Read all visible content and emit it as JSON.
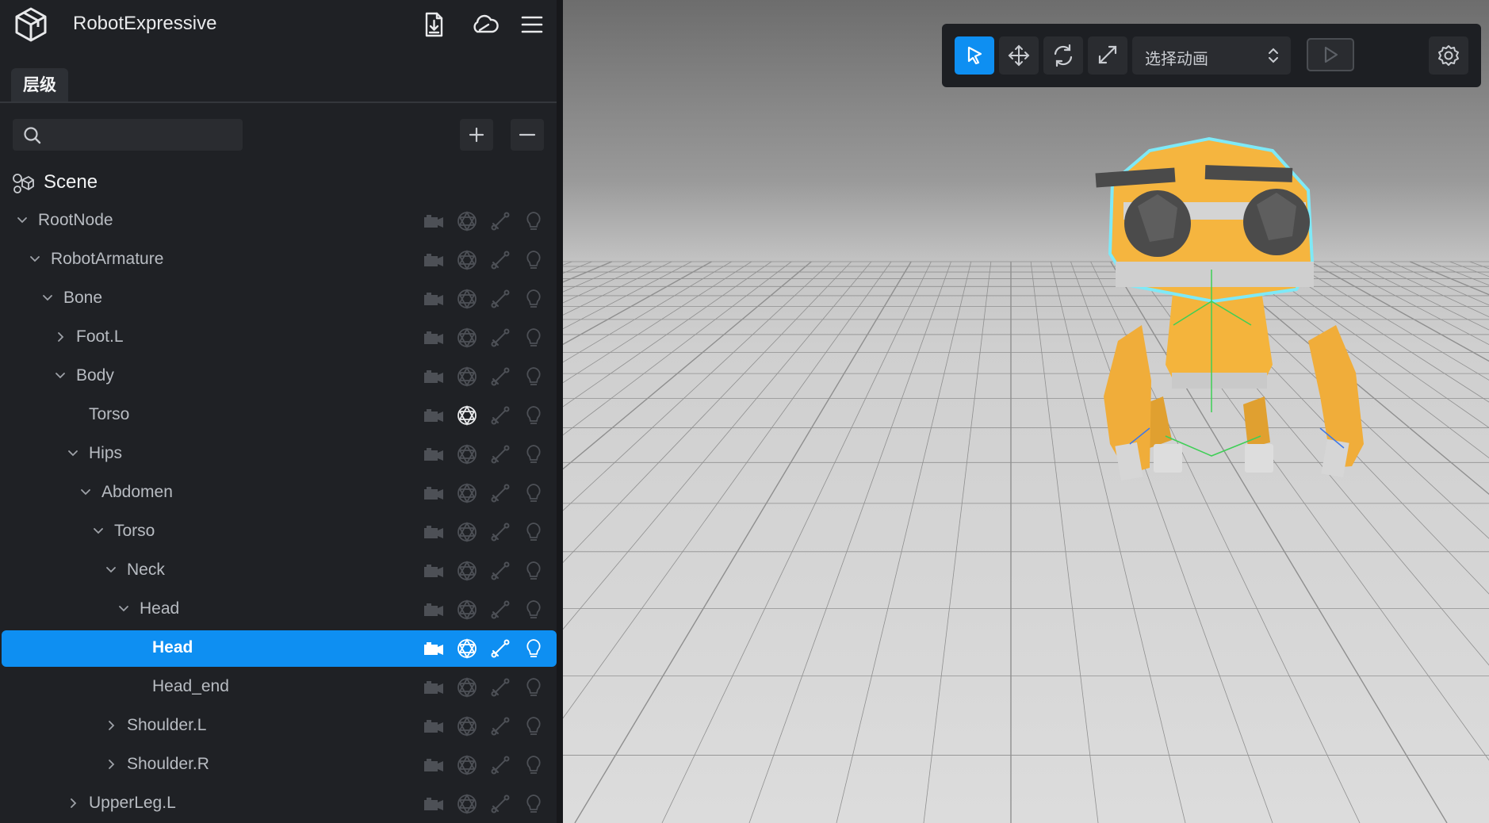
{
  "app": {
    "title": "RobotExpressive"
  },
  "tabs": [
    {
      "label": "层级"
    }
  ],
  "search": {
    "placeholder": ""
  },
  "scene": {
    "label": "Scene"
  },
  "tree": [
    {
      "label": "RootNode",
      "depth": 0,
      "chevron": "down"
    },
    {
      "label": "RobotArmature",
      "depth": 1,
      "chevron": "down"
    },
    {
      "label": "Bone",
      "depth": 2,
      "chevron": "down"
    },
    {
      "label": "Foot.L",
      "depth": 3,
      "chevron": "right"
    },
    {
      "label": "Body",
      "depth": 3,
      "chevron": "down"
    },
    {
      "label": "Torso",
      "depth": 4,
      "chevron": "none",
      "mesh_active": true
    },
    {
      "label": "Hips",
      "depth": 4,
      "chevron": "down"
    },
    {
      "label": "Abdomen",
      "depth": 5,
      "chevron": "down"
    },
    {
      "label": "Torso",
      "depth": 6,
      "chevron": "down"
    },
    {
      "label": "Neck",
      "depth": 7,
      "chevron": "down"
    },
    {
      "label": "Head",
      "depth": 8,
      "chevron": "down"
    },
    {
      "label": "Head",
      "depth": 9,
      "chevron": "none",
      "selected": true
    },
    {
      "label": "Head_end",
      "depth": 9,
      "chevron": "none"
    },
    {
      "label": "Shoulder.L",
      "depth": 7,
      "chevron": "right"
    },
    {
      "label": "Shoulder.R",
      "depth": 7,
      "chevron": "right"
    },
    {
      "label": "UpperLeg.L",
      "depth": 4,
      "chevron": "right"
    }
  ],
  "row_icons": [
    "camera-icon",
    "mesh-icon",
    "bone-icon",
    "light-bulb-icon"
  ],
  "toolbar": {
    "tools": [
      "select-tool-icon",
      "move-tool-icon",
      "rotate-tool-icon",
      "scale-tool-icon"
    ],
    "active_tool": "select-tool-icon",
    "animation_select": {
      "value": "选择动画"
    }
  },
  "colors": {
    "accent": "#0e8ff2",
    "sidebar_bg": "#1f2125",
    "robot": "#f5b53f",
    "outline": "#7ee9f7"
  }
}
